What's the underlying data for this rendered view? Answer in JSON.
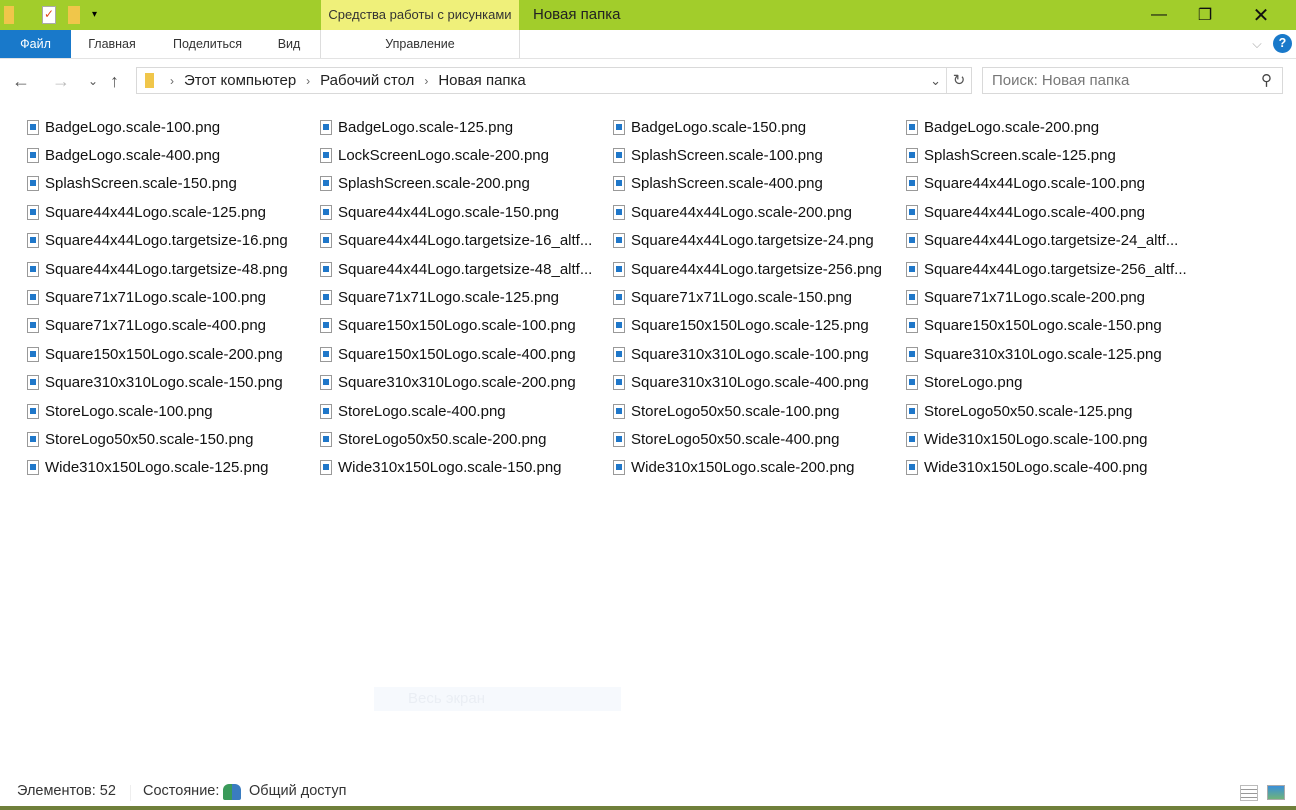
{
  "window": {
    "title": "Новая папка",
    "context_tab": "Средства работы с рисунками"
  },
  "ribbon": {
    "tabs": [
      "Файл",
      "Главная",
      "Поделиться",
      "Вид"
    ],
    "context_tab": "Управление"
  },
  "address": {
    "crumbs": [
      "Этот компьютер",
      "Рабочий стол",
      "Новая папка"
    ]
  },
  "search": {
    "placeholder": "Поиск: Новая папка"
  },
  "files": [
    "BadgeLogo.scale-100.png",
    "BadgeLogo.scale-125.png",
    "BadgeLogo.scale-150.png",
    "BadgeLogo.scale-200.png",
    "BadgeLogo.scale-400.png",
    "LockScreenLogo.scale-200.png",
    "SplashScreen.scale-100.png",
    "SplashScreen.scale-125.png",
    "SplashScreen.scale-150.png",
    "SplashScreen.scale-200.png",
    "SplashScreen.scale-400.png",
    "Square44x44Logo.scale-100.png",
    "Square44x44Logo.scale-125.png",
    "Square44x44Logo.scale-150.png",
    "Square44x44Logo.scale-200.png",
    "Square44x44Logo.scale-400.png",
    "Square44x44Logo.targetsize-16.png",
    "Square44x44Logo.targetsize-16_altf...",
    "Square44x44Logo.targetsize-24.png",
    "Square44x44Logo.targetsize-24_altf...",
    "Square44x44Logo.targetsize-48.png",
    "Square44x44Logo.targetsize-48_altf...",
    "Square44x44Logo.targetsize-256.png",
    "Square44x44Logo.targetsize-256_altf...",
    "Square71x71Logo.scale-100.png",
    "Square71x71Logo.scale-125.png",
    "Square71x71Logo.scale-150.png",
    "Square71x71Logo.scale-200.png",
    "Square71x71Logo.scale-400.png",
    "Square150x150Logo.scale-100.png",
    "Square150x150Logo.scale-125.png",
    "Square150x150Logo.scale-150.png",
    "Square150x150Logo.scale-200.png",
    "Square150x150Logo.scale-400.png",
    "Square310x310Logo.scale-100.png",
    "Square310x310Logo.scale-125.png",
    "Square310x310Logo.scale-150.png",
    "Square310x310Logo.scale-200.png",
    "Square310x310Logo.scale-400.png",
    "StoreLogo.png",
    "StoreLogo.scale-100.png",
    "StoreLogo.scale-400.png",
    "StoreLogo50x50.scale-100.png",
    "StoreLogo50x50.scale-125.png",
    "StoreLogo50x50.scale-150.png",
    "StoreLogo50x50.scale-200.png",
    "StoreLogo50x50.scale-400.png",
    "Wide310x150Logo.scale-100.png",
    "Wide310x150Logo.scale-125.png",
    "Wide310x150Logo.scale-150.png",
    "Wide310x150Logo.scale-200.png",
    "Wide310x150Logo.scale-400.png"
  ],
  "overlay": {
    "text": "Весь экран"
  },
  "status": {
    "count": "Элементов: 52",
    "state_label": "Состояние:",
    "state_value": "Общий доступ"
  }
}
